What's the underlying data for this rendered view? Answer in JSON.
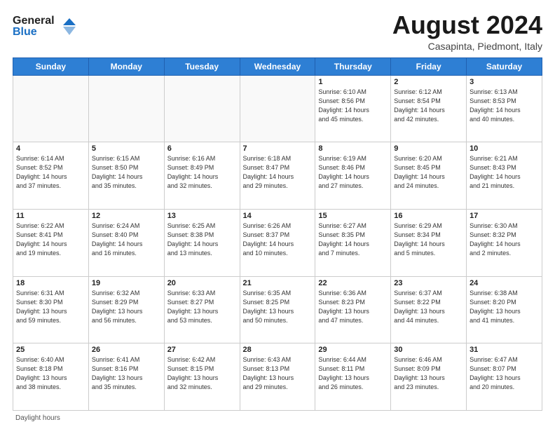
{
  "header": {
    "logo_general": "General",
    "logo_blue": "Blue",
    "month_year": "August 2024",
    "location": "Casapinta, Piedmont, Italy"
  },
  "days_of_week": [
    "Sunday",
    "Monday",
    "Tuesday",
    "Wednesday",
    "Thursday",
    "Friday",
    "Saturday"
  ],
  "weeks": [
    [
      {
        "day": "",
        "info": ""
      },
      {
        "day": "",
        "info": ""
      },
      {
        "day": "",
        "info": ""
      },
      {
        "day": "",
        "info": ""
      },
      {
        "day": "1",
        "info": "Sunrise: 6:10 AM\nSunset: 8:56 PM\nDaylight: 14 hours\nand 45 minutes."
      },
      {
        "day": "2",
        "info": "Sunrise: 6:12 AM\nSunset: 8:54 PM\nDaylight: 14 hours\nand 42 minutes."
      },
      {
        "day": "3",
        "info": "Sunrise: 6:13 AM\nSunset: 8:53 PM\nDaylight: 14 hours\nand 40 minutes."
      }
    ],
    [
      {
        "day": "4",
        "info": "Sunrise: 6:14 AM\nSunset: 8:52 PM\nDaylight: 14 hours\nand 37 minutes."
      },
      {
        "day": "5",
        "info": "Sunrise: 6:15 AM\nSunset: 8:50 PM\nDaylight: 14 hours\nand 35 minutes."
      },
      {
        "day": "6",
        "info": "Sunrise: 6:16 AM\nSunset: 8:49 PM\nDaylight: 14 hours\nand 32 minutes."
      },
      {
        "day": "7",
        "info": "Sunrise: 6:18 AM\nSunset: 8:47 PM\nDaylight: 14 hours\nand 29 minutes."
      },
      {
        "day": "8",
        "info": "Sunrise: 6:19 AM\nSunset: 8:46 PM\nDaylight: 14 hours\nand 27 minutes."
      },
      {
        "day": "9",
        "info": "Sunrise: 6:20 AM\nSunset: 8:45 PM\nDaylight: 14 hours\nand 24 minutes."
      },
      {
        "day": "10",
        "info": "Sunrise: 6:21 AM\nSunset: 8:43 PM\nDaylight: 14 hours\nand 21 minutes."
      }
    ],
    [
      {
        "day": "11",
        "info": "Sunrise: 6:22 AM\nSunset: 8:41 PM\nDaylight: 14 hours\nand 19 minutes."
      },
      {
        "day": "12",
        "info": "Sunrise: 6:24 AM\nSunset: 8:40 PM\nDaylight: 14 hours\nand 16 minutes."
      },
      {
        "day": "13",
        "info": "Sunrise: 6:25 AM\nSunset: 8:38 PM\nDaylight: 14 hours\nand 13 minutes."
      },
      {
        "day": "14",
        "info": "Sunrise: 6:26 AM\nSunset: 8:37 PM\nDaylight: 14 hours\nand 10 minutes."
      },
      {
        "day": "15",
        "info": "Sunrise: 6:27 AM\nSunset: 8:35 PM\nDaylight: 14 hours\nand 7 minutes."
      },
      {
        "day": "16",
        "info": "Sunrise: 6:29 AM\nSunset: 8:34 PM\nDaylight: 14 hours\nand 5 minutes."
      },
      {
        "day": "17",
        "info": "Sunrise: 6:30 AM\nSunset: 8:32 PM\nDaylight: 14 hours\nand 2 minutes."
      }
    ],
    [
      {
        "day": "18",
        "info": "Sunrise: 6:31 AM\nSunset: 8:30 PM\nDaylight: 13 hours\nand 59 minutes."
      },
      {
        "day": "19",
        "info": "Sunrise: 6:32 AM\nSunset: 8:29 PM\nDaylight: 13 hours\nand 56 minutes."
      },
      {
        "day": "20",
        "info": "Sunrise: 6:33 AM\nSunset: 8:27 PM\nDaylight: 13 hours\nand 53 minutes."
      },
      {
        "day": "21",
        "info": "Sunrise: 6:35 AM\nSunset: 8:25 PM\nDaylight: 13 hours\nand 50 minutes."
      },
      {
        "day": "22",
        "info": "Sunrise: 6:36 AM\nSunset: 8:23 PM\nDaylight: 13 hours\nand 47 minutes."
      },
      {
        "day": "23",
        "info": "Sunrise: 6:37 AM\nSunset: 8:22 PM\nDaylight: 13 hours\nand 44 minutes."
      },
      {
        "day": "24",
        "info": "Sunrise: 6:38 AM\nSunset: 8:20 PM\nDaylight: 13 hours\nand 41 minutes."
      }
    ],
    [
      {
        "day": "25",
        "info": "Sunrise: 6:40 AM\nSunset: 8:18 PM\nDaylight: 13 hours\nand 38 minutes."
      },
      {
        "day": "26",
        "info": "Sunrise: 6:41 AM\nSunset: 8:16 PM\nDaylight: 13 hours\nand 35 minutes."
      },
      {
        "day": "27",
        "info": "Sunrise: 6:42 AM\nSunset: 8:15 PM\nDaylight: 13 hours\nand 32 minutes."
      },
      {
        "day": "28",
        "info": "Sunrise: 6:43 AM\nSunset: 8:13 PM\nDaylight: 13 hours\nand 29 minutes."
      },
      {
        "day": "29",
        "info": "Sunrise: 6:44 AM\nSunset: 8:11 PM\nDaylight: 13 hours\nand 26 minutes."
      },
      {
        "day": "30",
        "info": "Sunrise: 6:46 AM\nSunset: 8:09 PM\nDaylight: 13 hours\nand 23 minutes."
      },
      {
        "day": "31",
        "info": "Sunrise: 6:47 AM\nSunset: 8:07 PM\nDaylight: 13 hours\nand 20 minutes."
      }
    ]
  ],
  "footer": {
    "daylight_label": "Daylight hours"
  }
}
